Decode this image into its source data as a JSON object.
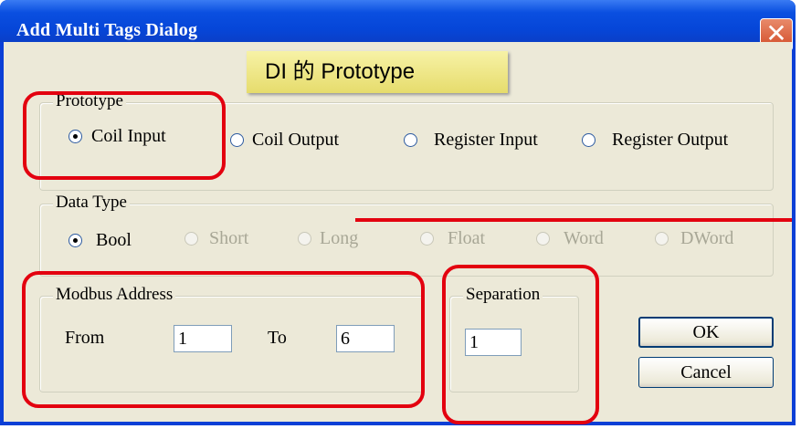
{
  "window": {
    "title": "Add Multi Tags Dialog",
    "close_glyph": "✕"
  },
  "callout": {
    "text": "DI 的 Prototype"
  },
  "prototype": {
    "legend": "Prototype",
    "options": [
      {
        "label": "Coil Input",
        "selected": true,
        "enabled": true
      },
      {
        "label": "Coil Output",
        "selected": false,
        "enabled": true
      },
      {
        "label": "Register Input",
        "selected": false,
        "enabled": true
      },
      {
        "label": "Register Output",
        "selected": false,
        "enabled": true
      }
    ]
  },
  "data_type": {
    "legend": "Data Type",
    "options": [
      {
        "label": "Bool",
        "selected": true,
        "enabled": true
      },
      {
        "label": "Short",
        "selected": false,
        "enabled": false
      },
      {
        "label": "Long",
        "selected": false,
        "enabled": false
      },
      {
        "label": "Float",
        "selected": false,
        "enabled": false
      },
      {
        "label": "Word",
        "selected": false,
        "enabled": false
      },
      {
        "label": "DWord",
        "selected": false,
        "enabled": false
      }
    ]
  },
  "modbus": {
    "legend": "Modbus Address",
    "from_label": "From",
    "from_value": "1",
    "to_label": "To",
    "to_value": "6"
  },
  "separation": {
    "legend": "Separation",
    "value": "1"
  },
  "buttons": {
    "ok": "OK",
    "cancel": "Cancel"
  },
  "colors": {
    "title_bar": "#0646d8",
    "dialog_face": "#ece9d8",
    "annotation_red": "#e3000f",
    "callout_yellow": "#f0e68c"
  }
}
